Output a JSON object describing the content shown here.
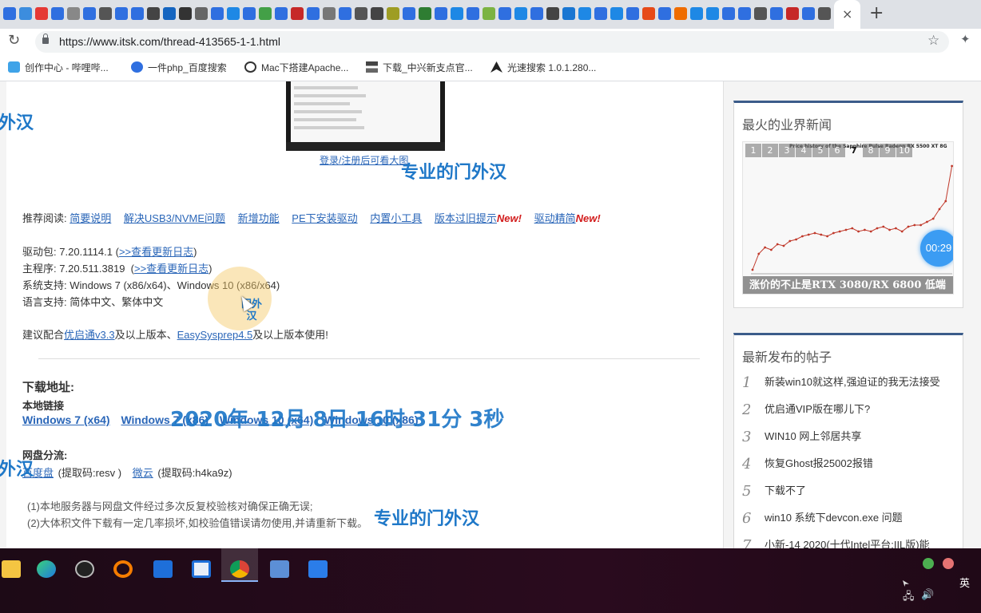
{
  "browser": {
    "active_tab_close": "×",
    "new_tab": "+",
    "url": "https://www.itsk.com/thread-413565-1-1.html",
    "bookmarks": [
      {
        "label": "创作中心 - 哔哩哔...",
        "icon": "bilibili-icon"
      },
      {
        "label": "一件php_百度搜索",
        "icon": "baidu-paw-icon"
      },
      {
        "label": "Mac下搭建Apache...",
        "icon": "site-icon"
      },
      {
        "label": "下载_中兴新支点官...",
        "icon": "zte-icon"
      },
      {
        "label": "光速搜索 1.0.1.280...",
        "icon": "rocket-icon"
      }
    ]
  },
  "content": {
    "image_caption": "登录/注册后可看大图",
    "recommend_label": "推荐阅读:",
    "recommend_links": [
      "简要说明",
      "解决USB3/NVME问题",
      "新增功能",
      "PE下安装驱动",
      "内置小工具",
      "版本过旧提示",
      "驱动精简"
    ],
    "new_badge": "New!",
    "driver_pkg_label": "驱动包:",
    "driver_pkg_value": "7.20.1114.1",
    "changelog_link": ">>查看更新日志",
    "main_prog_label": "主程序:",
    "main_prog_value": "7.20.511.3819",
    "os_support_label": "系统支持:",
    "os_support_value": "Windows 7 (x86/x64)、Windows 10 (x86/x64)",
    "lang_label": "语言支持:",
    "lang_value": "简体中文、繁体中文",
    "advice_prefix": "建议配合",
    "advice_link1": "优启通v3.3",
    "advice_mid": "及以上版本、",
    "advice_link2": "EasySysprep4.5",
    "advice_suffix": "及以上版本使用!",
    "download_heading": "下载地址:",
    "local_heading": "本地链接",
    "local_links": [
      "Windows 7 (x64)",
      "Windows 7 (x86)",
      "Windows 10 (x64)",
      "Windows 10 (x86)"
    ],
    "cloud_heading": "网盘分流:",
    "cloud1": "百度盘",
    "cloud1_code": "(提取码:resv )",
    "cloud2": "微云",
    "cloud2_code": "(提取码:h4ka9z)",
    "note1": "(1)本地服务器与网盘文件经过多次反复校验核对确保正确无误;",
    "note2": "(2)大体积文件下载有一定几率损坏,如校验值错误请勿使用,并请重新下载。"
  },
  "overlays": {
    "watermark": "专业的门外汉",
    "watermark_edge": "外汉",
    "timestamp": "2020年 12月 8日 16时 31分 3秒",
    "cursor_label": "门外汉"
  },
  "sidebar": {
    "hot_news_title": "最火的业界新闻",
    "pager": [
      "1",
      "2",
      "3",
      "4",
      "5",
      "6",
      "7",
      "8",
      "9",
      "10"
    ],
    "pager_current": "7",
    "chart_title": "Price history of the Sapphire Pulse Radeon RX 5500 XT 8G",
    "news_caption": "涨价的不止是RTX 3080/RX 6800 低端",
    "timer": "00:29",
    "latest_title": "最新发布的帖子",
    "posts": [
      {
        "num": "1",
        "title": "新装win10就这样,强迫证的我无法接受"
      },
      {
        "num": "2",
        "title": "优启通VIP版在哪儿下?"
      },
      {
        "num": "3",
        "title": "WIN10 网上邻居共享"
      },
      {
        "num": "4",
        "title": "恢复Ghost报25002报错"
      },
      {
        "num": "5",
        "title": "下载不了"
      },
      {
        "num": "6",
        "title": "win10 系统下devcon.exe 问题"
      },
      {
        "num": "7",
        "title": "小新-14 2020(十代Intel平台:IIL版)能"
      }
    ]
  },
  "taskbar": {
    "ime": "英",
    "apps": [
      "explorer",
      "edge",
      "obs",
      "search-tool",
      "window-app",
      "window-app-2",
      "chrome",
      "network-tool",
      "feishu"
    ]
  },
  "colors": {
    "link": "#2a66b8",
    "watermark": "#1f78c8",
    "new_badge": "#d21c1c",
    "card_accent": "#3b5c8a"
  }
}
